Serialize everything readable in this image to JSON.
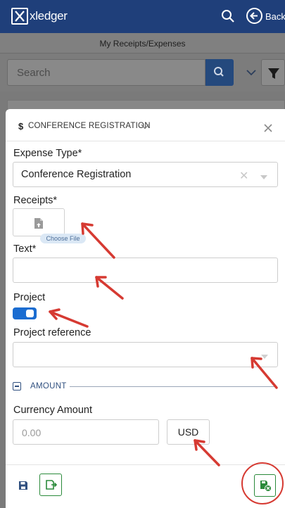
{
  "app": {
    "logo_text": "xledger",
    "back_label": "Back",
    "page_subtitle": "My Receipts/Expenses"
  },
  "search": {
    "placeholder": "Search"
  },
  "form": {
    "header_currency_symbol": "$",
    "header_title": "CONFERENCE REGISTRATION",
    "expense_type_label": "Expense Type*",
    "expense_type_value": "Conference Registration",
    "receipts_label": "Receipts*",
    "choose_file_label": "Choose File",
    "text_label": "Text*",
    "text_value": "",
    "project_label": "Project",
    "project_enabled": true,
    "project_reference_label": "Project reference",
    "project_reference_value": "",
    "amount_section_label": "AMOUNT",
    "currency_amount_label": "Currency Amount",
    "currency_amount_placeholder": "0.00",
    "currency_code": "USD"
  },
  "colors": {
    "top_bar": "#1f3f7a",
    "accent_blue": "#1b6dd1",
    "search_button": "#24497d",
    "action_green": "#2a8a3a",
    "annotation_red": "#d63a32"
  },
  "icons": {
    "search": "search-icon",
    "back": "back-arrow-icon",
    "filter": "filter-icon",
    "dropdown": "chevron-down-icon",
    "close": "close-icon",
    "upload": "file-upload-icon",
    "save": "save-icon",
    "submit": "submit-icon",
    "delete_receipt": "delete-receipt-icon"
  }
}
